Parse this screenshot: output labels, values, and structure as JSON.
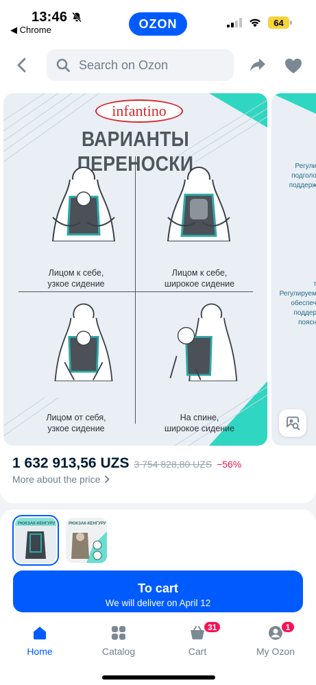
{
  "status_bar": {
    "time": "13:46",
    "back_app": "◀ Chrome",
    "app_logo": "OZON",
    "battery": "64",
    "colors": {
      "brand": "#005bff",
      "battery": "#f7d23b"
    }
  },
  "top_bar": {
    "search_placeholder": "Search on Ozon",
    "icons": [
      "chevron-left-icon",
      "search-icon",
      "share-icon",
      "heart-icon"
    ]
  },
  "gallery": {
    "brand": "infantino",
    "title": "ВАРИАНТЫ ПЕРЕНОСКИ",
    "positions": [
      {
        "line1": "Лицом к себе,",
        "line2": "узкое сидение"
      },
      {
        "line1": "Лицом к себе,",
        "line2": "широкое сидение"
      },
      {
        "line1": "Лицом от себя,",
        "line2": "узкое сидение"
      },
      {
        "line1": "На спине,",
        "line2": "широкое сидение"
      }
    ],
    "next_image_text": {
      "line1": "Регули",
      "line2": "подголо",
      "line3": "поддерж",
      "line4": "т",
      "line5": "Регулируем",
      "line6": "обеспеч",
      "line7": "поддер",
      "line8": "поясн"
    },
    "colors": {
      "accent": "#2fd6c2",
      "background": "#e9eff4"
    }
  },
  "price": {
    "current": "1 632 913,56 UZS",
    "old": "3 754 828,80 UZS",
    "discount": "−56%",
    "more_link": "More about the price",
    "colors": {
      "discount": "#f91155"
    }
  },
  "variants": {
    "thumbs": [
      {
        "label": "РЮКЗАК-КЕНГУРУ",
        "selected": true
      },
      {
        "label": "РЮКЗАК-КЕНГУРУ",
        "selected": false
      }
    ]
  },
  "cta": {
    "title": "To cart",
    "subtitle": "We will deliver on April 12"
  },
  "tab_bar": {
    "tabs": [
      {
        "label": "Home",
        "icon": "home-icon",
        "active": true
      },
      {
        "label": "Catalog",
        "icon": "catalog-icon",
        "active": false
      },
      {
        "label": "Cart",
        "icon": "cart-icon",
        "badge": "31",
        "active": false
      },
      {
        "label": "My Ozon",
        "icon": "profile-icon",
        "badge": "1",
        "active": false
      }
    ]
  }
}
